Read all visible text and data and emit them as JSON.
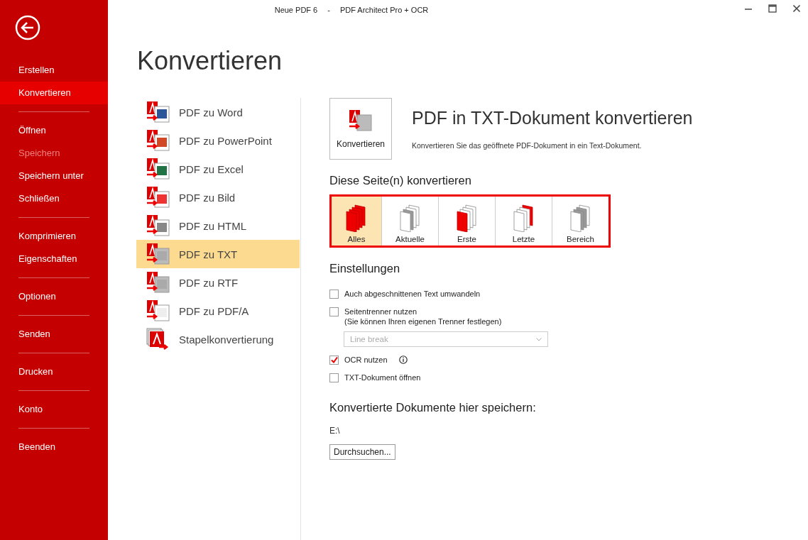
{
  "window": {
    "title_parts": [
      "Neue PDF 6",
      "-",
      "PDF Architect Pro + OCR"
    ]
  },
  "sidebar": {
    "groups": [
      [
        {
          "label": "Erstellen",
          "selected": false,
          "disabled": false
        },
        {
          "label": "Konvertieren",
          "selected": true,
          "disabled": false
        }
      ],
      [
        {
          "label": "Öffnen",
          "selected": false,
          "disabled": false
        },
        {
          "label": "Speichern",
          "selected": false,
          "disabled": true
        },
        {
          "label": "Speichern unter",
          "selected": false,
          "disabled": false
        },
        {
          "label": "Schließen",
          "selected": false,
          "disabled": false
        }
      ],
      [
        {
          "label": "Komprimieren",
          "selected": false,
          "disabled": false
        },
        {
          "label": "Eigenschaften",
          "selected": false,
          "disabled": false
        }
      ],
      [
        {
          "label": "Optionen",
          "selected": false,
          "disabled": false
        }
      ],
      [
        {
          "label": "Senden",
          "selected": false,
          "disabled": false
        }
      ],
      [
        {
          "label": "Drucken",
          "selected": false,
          "disabled": false
        }
      ],
      [
        {
          "label": "Konto",
          "selected": false,
          "disabled": false
        }
      ],
      [
        {
          "label": "Beenden",
          "selected": false,
          "disabled": false
        }
      ]
    ]
  },
  "page_title": "Konvertieren",
  "formats": [
    {
      "label": "PDF zu Word",
      "kind": "word",
      "selected": false
    },
    {
      "label": "PDF zu PowerPoint",
      "kind": "powerpoint",
      "selected": false
    },
    {
      "label": "PDF zu Excel",
      "kind": "excel",
      "selected": false
    },
    {
      "label": "PDF zu Bild",
      "kind": "image",
      "selected": false
    },
    {
      "label": "PDF zu HTML",
      "kind": "html",
      "selected": false
    },
    {
      "label": "PDF zu TXT",
      "kind": "txt",
      "selected": true
    },
    {
      "label": "PDF zu RTF",
      "kind": "rtf",
      "selected": false
    },
    {
      "label": "PDF zu PDF/A",
      "kind": "pdfa",
      "selected": false
    },
    {
      "label": "Stapelkonvertierung",
      "kind": "batch",
      "selected": false
    }
  ],
  "convert_button": "Konvertieren",
  "detail": {
    "title": "PDF in TXT-Dokument konvertieren",
    "description": "Konvertieren Sie das geöffnete PDF-Dokument in ein Text-Dokument."
  },
  "pages": {
    "heading": "Diese Seite(n) konvertieren",
    "options": [
      {
        "label": "Alles",
        "kind": "all",
        "selected": true
      },
      {
        "label": "Aktuelle",
        "kind": "current",
        "selected": false
      },
      {
        "label": "Erste",
        "kind": "first",
        "selected": false
      },
      {
        "label": "Letzte",
        "kind": "last",
        "selected": false
      },
      {
        "label": "Bereich",
        "kind": "range",
        "selected": false
      }
    ]
  },
  "settings": {
    "heading": "Einstellungen",
    "items": [
      {
        "kind": "checkbox",
        "label": "Auch abgeschnittenen Text umwandeln",
        "checked": false
      },
      {
        "kind": "checkbox",
        "label": "Seitentrenner nutzen",
        "note": "(Sie können Ihren eigenen Trenner festlegen)",
        "checked": false
      },
      {
        "kind": "dropdown",
        "value": "Line break",
        "disabled": true
      },
      {
        "kind": "checkbox",
        "label": "OCR nutzen",
        "checked": true,
        "info": true
      },
      {
        "kind": "checkbox",
        "label": "TXT-Dokument öffnen",
        "checked": false
      }
    ]
  },
  "save": {
    "heading": "Konvertierte Dokumente hier speichern:",
    "path": "E:\\",
    "button": "Durchsuchen..."
  }
}
